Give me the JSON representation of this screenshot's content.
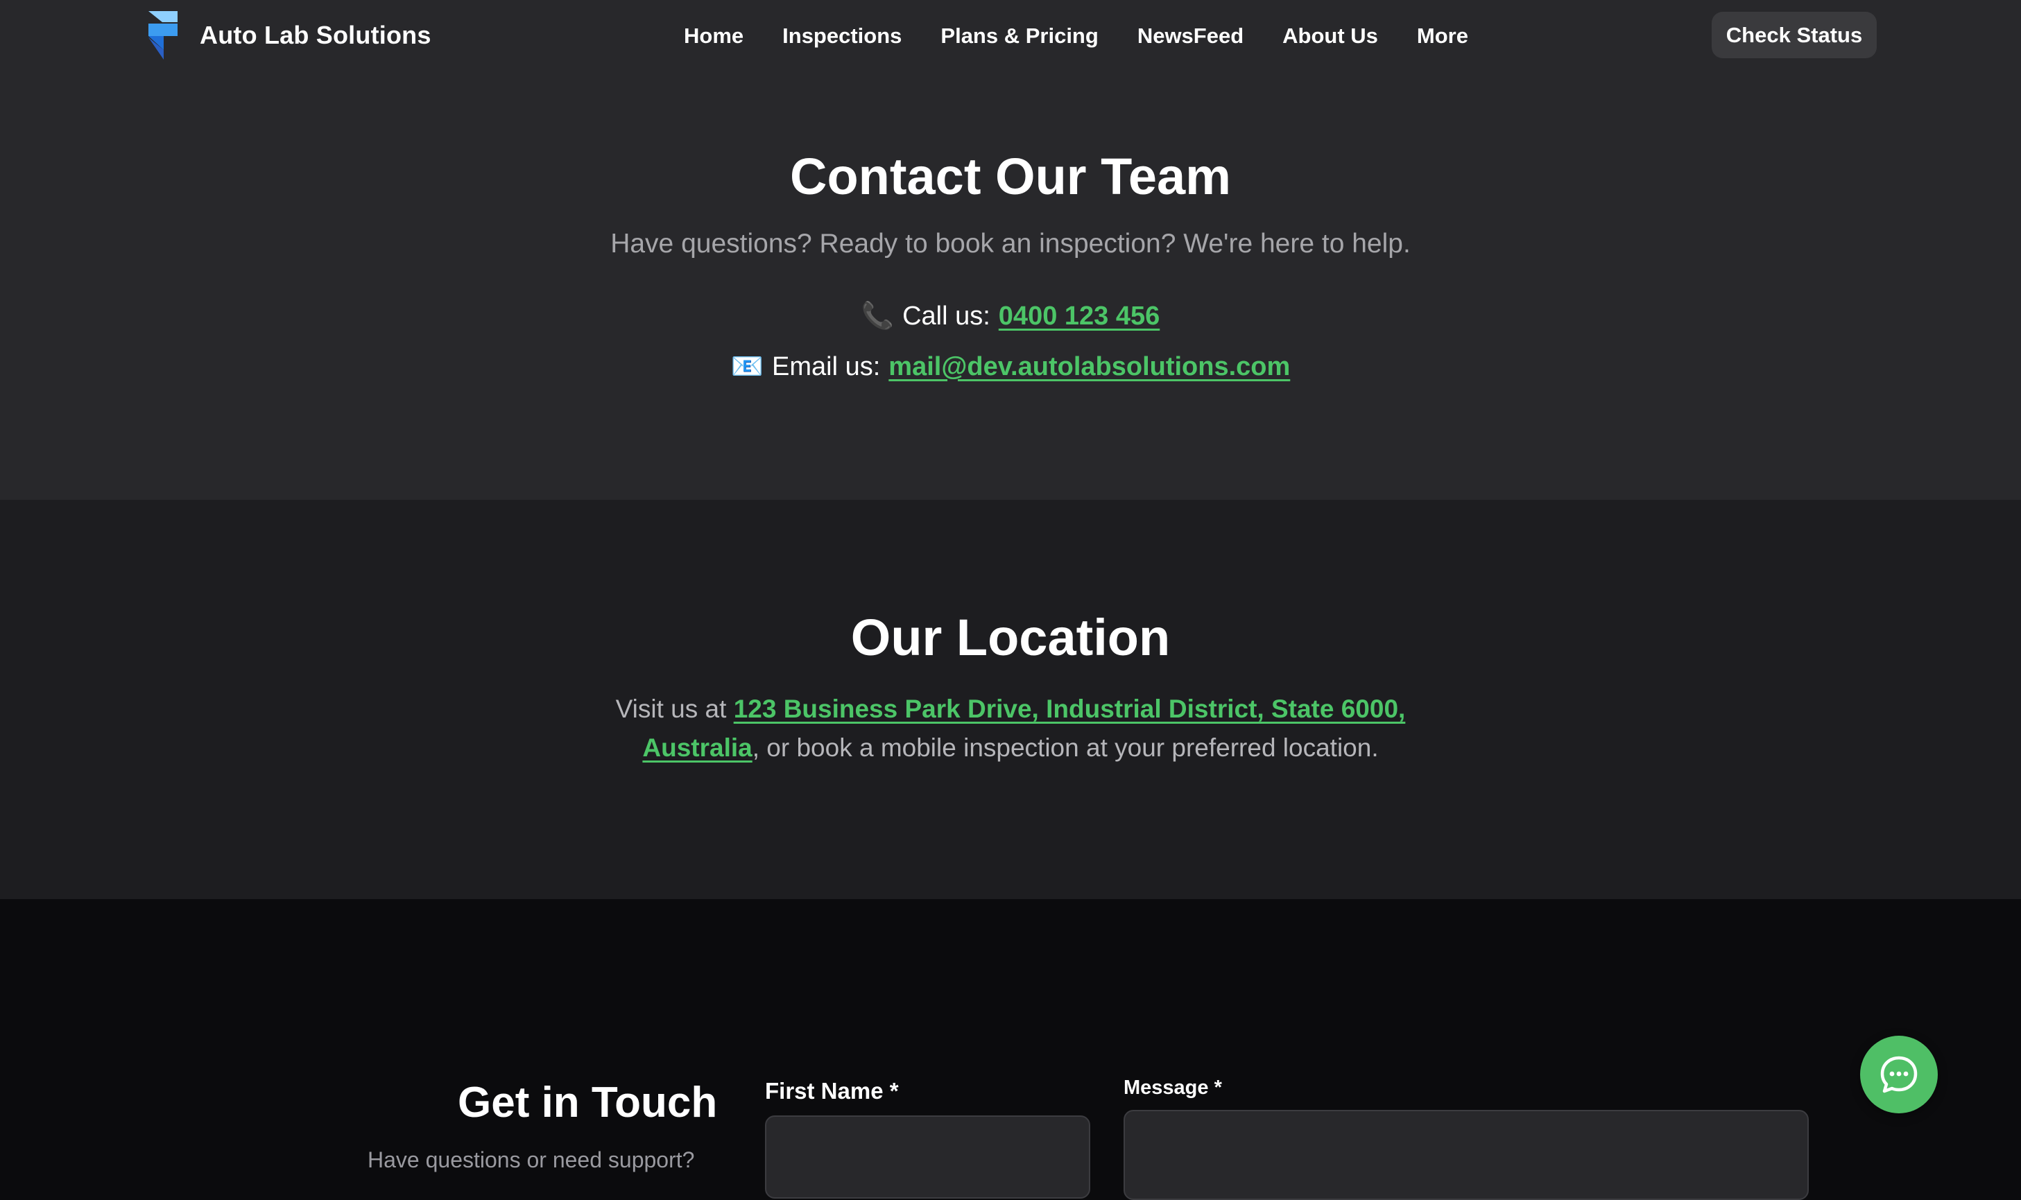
{
  "header": {
    "brand_name": "Auto Lab Solutions",
    "nav": [
      "Home",
      "Inspections",
      "Plans & Pricing",
      "NewsFeed",
      "About Us",
      "More"
    ],
    "check_status_label": "Check Status"
  },
  "contact": {
    "title": "Contact Our Team",
    "subtitle": "Have questions? Ready to book an inspection? We're here to help.",
    "phone_icon": "📞",
    "phone_prefix": "Call us:",
    "phone": "0400 123 456",
    "email_icon": "📧",
    "email_prefix": "Email us:",
    "email": "mail@dev.autolabsolutions.com"
  },
  "location": {
    "title": "Our Location",
    "text_prefix": "Visit us at",
    "address": "123 Business Park Drive, Industrial District, State 6000, Australia",
    "text_suffix": ", or book a mobile inspection at your preferred location."
  },
  "form": {
    "title": "Get in Touch",
    "subtitle": "Have questions or need support?",
    "first_name_label": "First Name *",
    "message_label": "Message *"
  },
  "colors": {
    "accent_green": "#4cc567",
    "header_bg": "#28282b",
    "location_bg": "#1d1d20",
    "page_bg": "#0b0b0d"
  }
}
